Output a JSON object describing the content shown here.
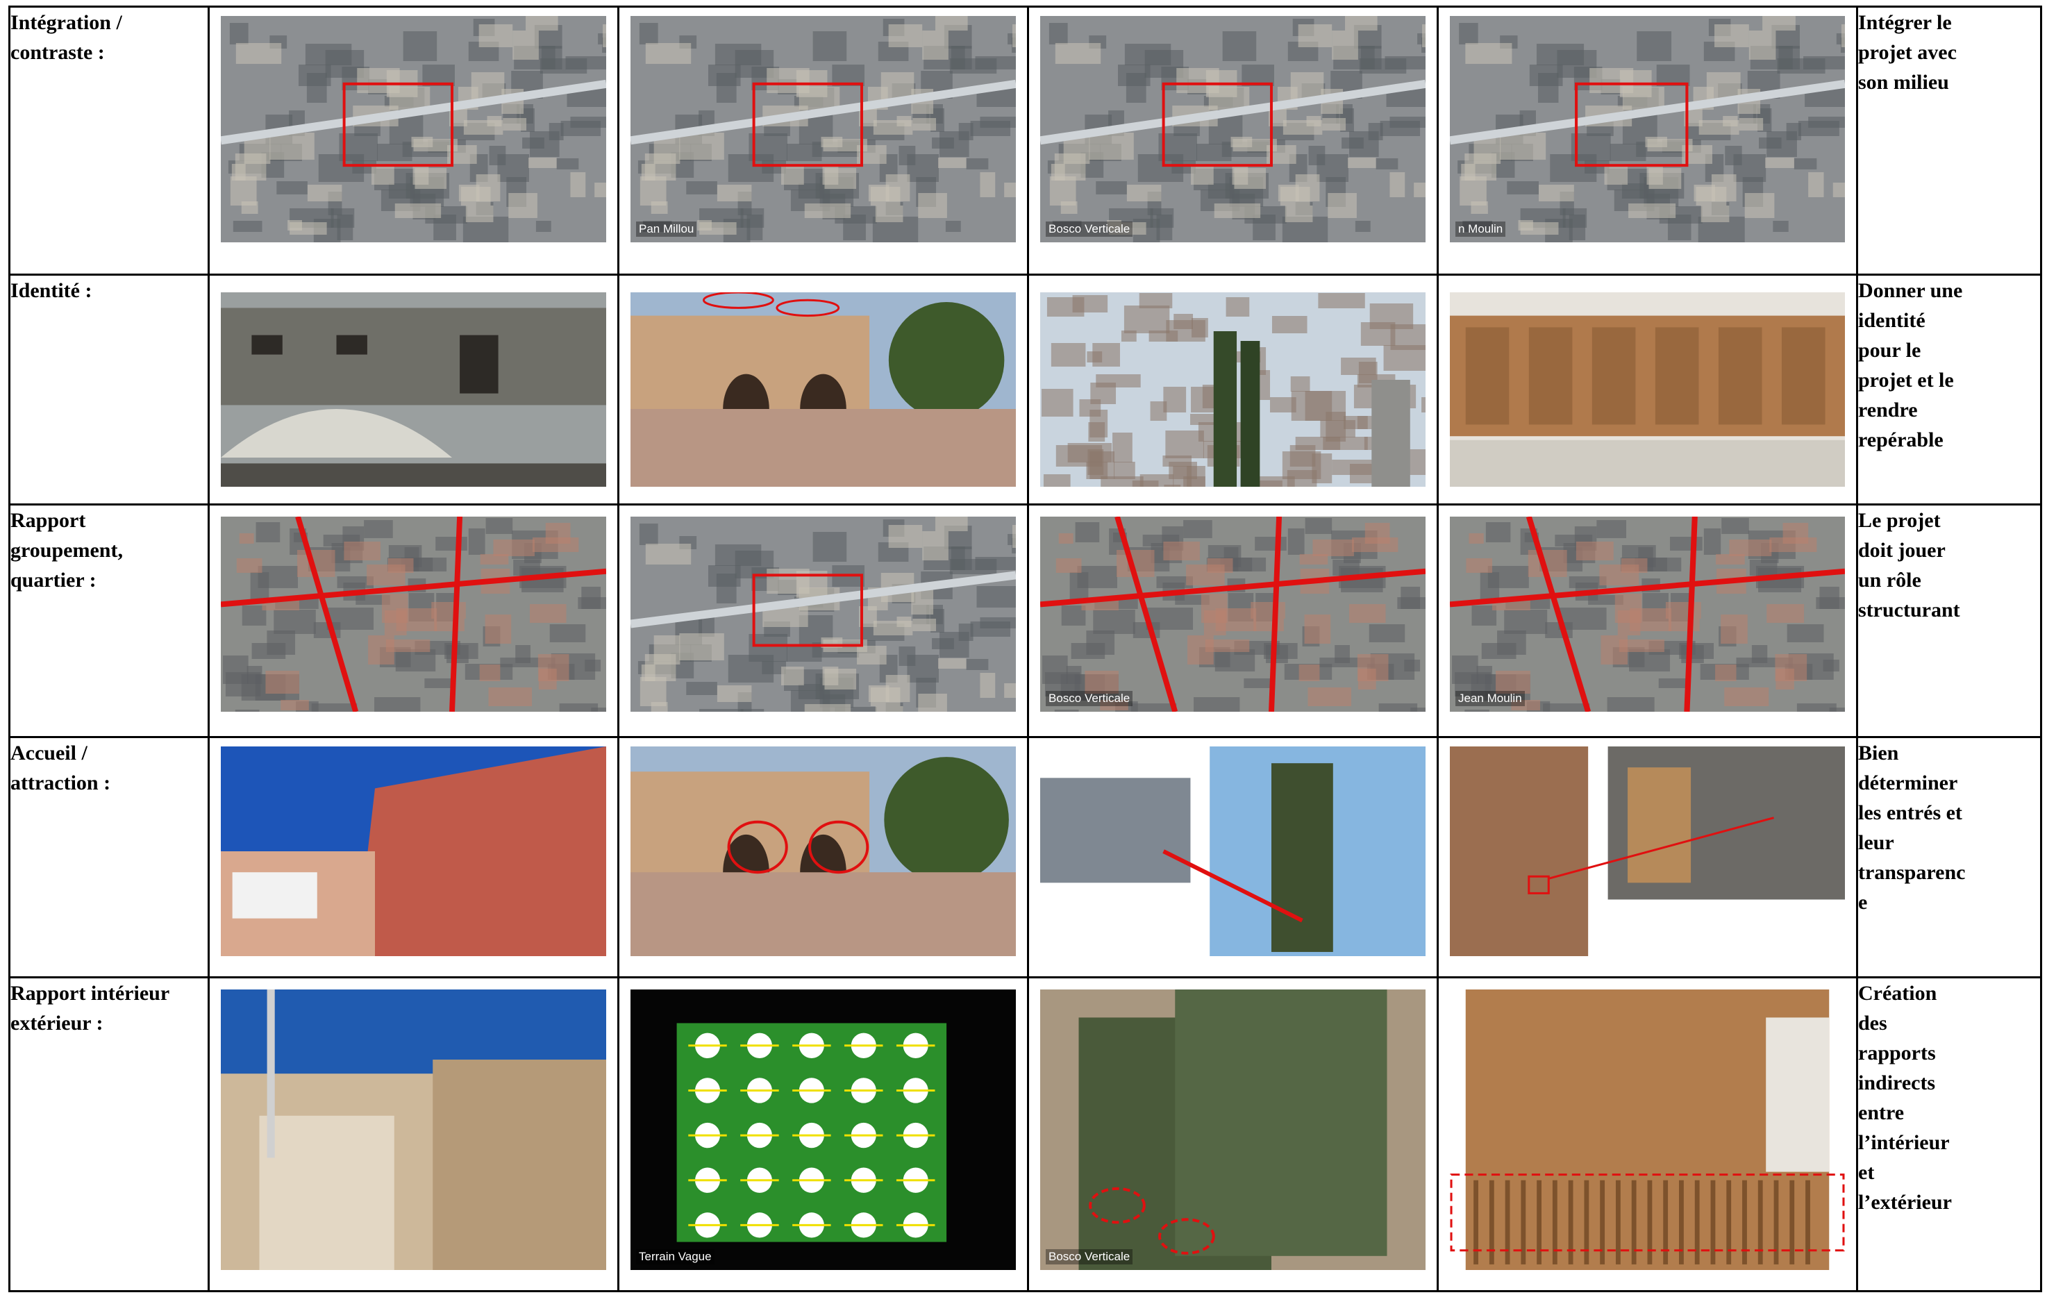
{
  "rows": [
    {
      "label": "Intégration /\ncontraste :",
      "conclusion": "Intégrer le\nprojet avec\nson milieu",
      "images": [
        {
          "icon": "aerial-map-marked-block"
        },
        {
          "icon": "aerial-map-marked-block",
          "caption": "Pan Millou"
        },
        {
          "icon": "aerial-map-marked-block",
          "caption": "Bosco Verticale"
        },
        {
          "icon": "aerial-map-marked-block",
          "caption": "n Moulin"
        }
      ]
    },
    {
      "label": "Identité :",
      "conclusion": "Donner  une\nidentité\npour le\nprojet  et le\nrendre\nrepérable",
      "images": [
        {
          "icon": "stone-house-photo"
        },
        {
          "icon": "facade-photo-circled-windows"
        },
        {
          "icon": "city-skyline-photo"
        },
        {
          "icon": "wooden-housing-facade-photo"
        }
      ]
    },
    {
      "label": "Rapport\ngroupement,\nquartier :",
      "conclusion": "Le projet\ndoit jouer\nun rôle\nstructurant",
      "images": [
        {
          "icon": "aerial-map-street-lines"
        },
        {
          "icon": "aerial-map-marked-block"
        },
        {
          "icon": "aerial-map-street-lines",
          "caption": "Bosco Verticale"
        },
        {
          "icon": "aerial-map-street-lines",
          "caption": "Jean Moulin"
        }
      ]
    },
    {
      "label": "Accueil  /\nattraction :",
      "conclusion": "Bien\ndéterminer\nles entrés et\nleur\ntransparenc\ne",
      "images": [
        {
          "icon": "ksar-street-photo"
        },
        {
          "icon": "facade-photo-circled-entrances"
        },
        {
          "icon": "lobby-and-tower-photos-arrow"
        },
        {
          "icon": "entrance-and-door-photos-arrow"
        }
      ]
    },
    {
      "label": "Rapport intérieur\nextérieur :",
      "conclusion": "Création\ndes\nrapports\nindirects\nentre\nl’intérieur\net\nl’extérieur",
      "images": [
        {
          "icon": "courtyard-houses-photo"
        },
        {
          "icon": "site-plan-drawing",
          "caption": "Terrain Vague"
        },
        {
          "icon": "tower-aerial-photo-circled",
          "caption": "Bosco Verticale"
        },
        {
          "icon": "wooden-facade-photo-dashed-box"
        }
      ]
    }
  ],
  "colors": {
    "border": "#000000",
    "marker": "#e01010"
  }
}
